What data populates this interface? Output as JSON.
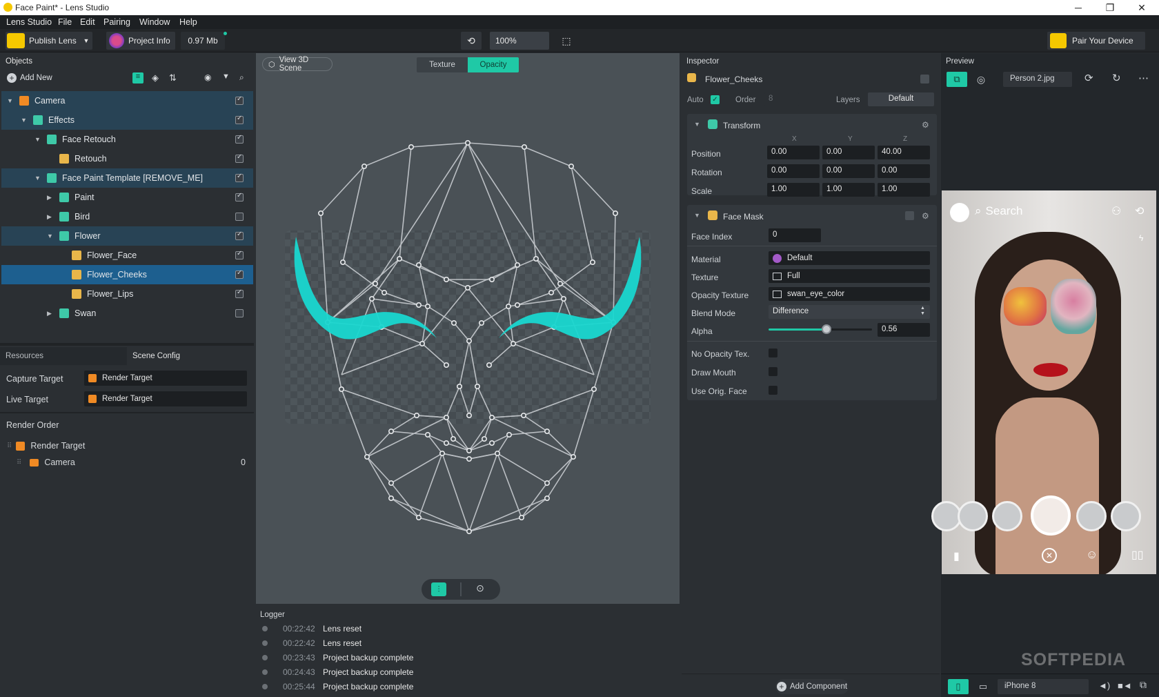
{
  "window": {
    "title": "Face Paint* - Lens Studio",
    "minimize_icon": "minimize-icon",
    "maximize_icon": "maximize-icon",
    "close_icon": "close-icon"
  },
  "menu": [
    "Lens Studio",
    "File",
    "Edit",
    "Pairing",
    "Window",
    "Help"
  ],
  "toolbar": {
    "publish_label": "Publish Lens",
    "project_info_label": "Project Info",
    "size": "0.97 Mb",
    "zoom": "100%",
    "pair_label": "Pair Your Device"
  },
  "objects": {
    "title": "Objects",
    "add_new": "Add New",
    "tree": [
      {
        "label": "Camera",
        "checked": true
      },
      {
        "label": "Effects",
        "checked": true
      },
      {
        "label": "Face Retouch",
        "checked": true
      },
      {
        "label": "Retouch",
        "checked": true
      },
      {
        "label": "Face Paint Template [REMOVE_ME]",
        "checked": true
      },
      {
        "label": "Paint",
        "checked": true
      },
      {
        "label": "Bird",
        "checked": false
      },
      {
        "label": "Flower",
        "checked": true
      },
      {
        "label": "Flower_Face",
        "checked": true
      },
      {
        "label": "Flower_Cheeks",
        "checked": true
      },
      {
        "label": "Flower_Lips",
        "checked": true
      },
      {
        "label": "Swan",
        "checked": false
      }
    ]
  },
  "resources": {
    "tab_resources": "Resources",
    "tab_scene_config": "Scene Config",
    "capture_target_label": "Capture Target",
    "capture_target_value": "Render Target",
    "live_target_label": "Live Target",
    "live_target_value": "Render Target"
  },
  "render_order": {
    "title": "Render Order",
    "items": [
      {
        "label": "Render Target",
        "value": ""
      },
      {
        "label": "Camera",
        "value": "0"
      }
    ]
  },
  "viewport": {
    "view3d_label": "View 3D Scene",
    "tab_texture": "Texture",
    "tab_opacity": "Opacity"
  },
  "logger": {
    "title": "Logger",
    "entries": [
      {
        "time": "00:22:42",
        "message": "Lens reset"
      },
      {
        "time": "00:22:42",
        "message": "Lens reset"
      },
      {
        "time": "00:23:43",
        "message": "Project backup complete"
      },
      {
        "time": "00:24:43",
        "message": "Project backup complete"
      },
      {
        "time": "00:25:44",
        "message": "Project backup complete"
      }
    ]
  },
  "inspector": {
    "title": "Inspector",
    "object_name": "Flower_Cheeks",
    "auto_label": "Auto",
    "order_label": "Order",
    "order_value": "8",
    "layers_label": "Layers",
    "layers_value": "Default",
    "transform": {
      "title": "Transform",
      "col_x": "X",
      "col_y": "Y",
      "col_z": "Z",
      "rows": [
        {
          "label": "Position",
          "x": "0.00",
          "y": "0.00",
          "z": "40.00"
        },
        {
          "label": "Rotation",
          "x": "0.00",
          "y": "0.00",
          "z": "0.00"
        },
        {
          "label": "Scale",
          "x": "1.00",
          "y": "1.00",
          "z": "1.00"
        }
      ]
    },
    "face_mask": {
      "title": "Face Mask",
      "face_index_label": "Face Index",
      "face_index": "0",
      "material_label": "Material",
      "material": "Default",
      "texture_label": "Texture",
      "texture": "Full",
      "opacity_texture_label": "Opacity Texture",
      "opacity_texture": "swan_eye_color",
      "blend_mode_label": "Blend Mode",
      "blend_mode": "Difference",
      "alpha_label": "Alpha",
      "alpha": "0.56",
      "alpha_fraction": 0.56,
      "no_opacity_label": "No Opacity Tex.",
      "draw_mouth_label": "Draw Mouth",
      "use_orig_face_label": "Use Orig. Face"
    },
    "add_component": "Add Component"
  },
  "preview": {
    "title": "Preview",
    "image_name": "Person 2.jpg",
    "search_placeholder": "Search",
    "device": "iPhone 8",
    "watermark": "SOFTPEDIA"
  },
  "colors": {
    "accent": "#1fc9a6",
    "selection": "#1d5f8f",
    "teal_mask": "#19d7d0"
  }
}
